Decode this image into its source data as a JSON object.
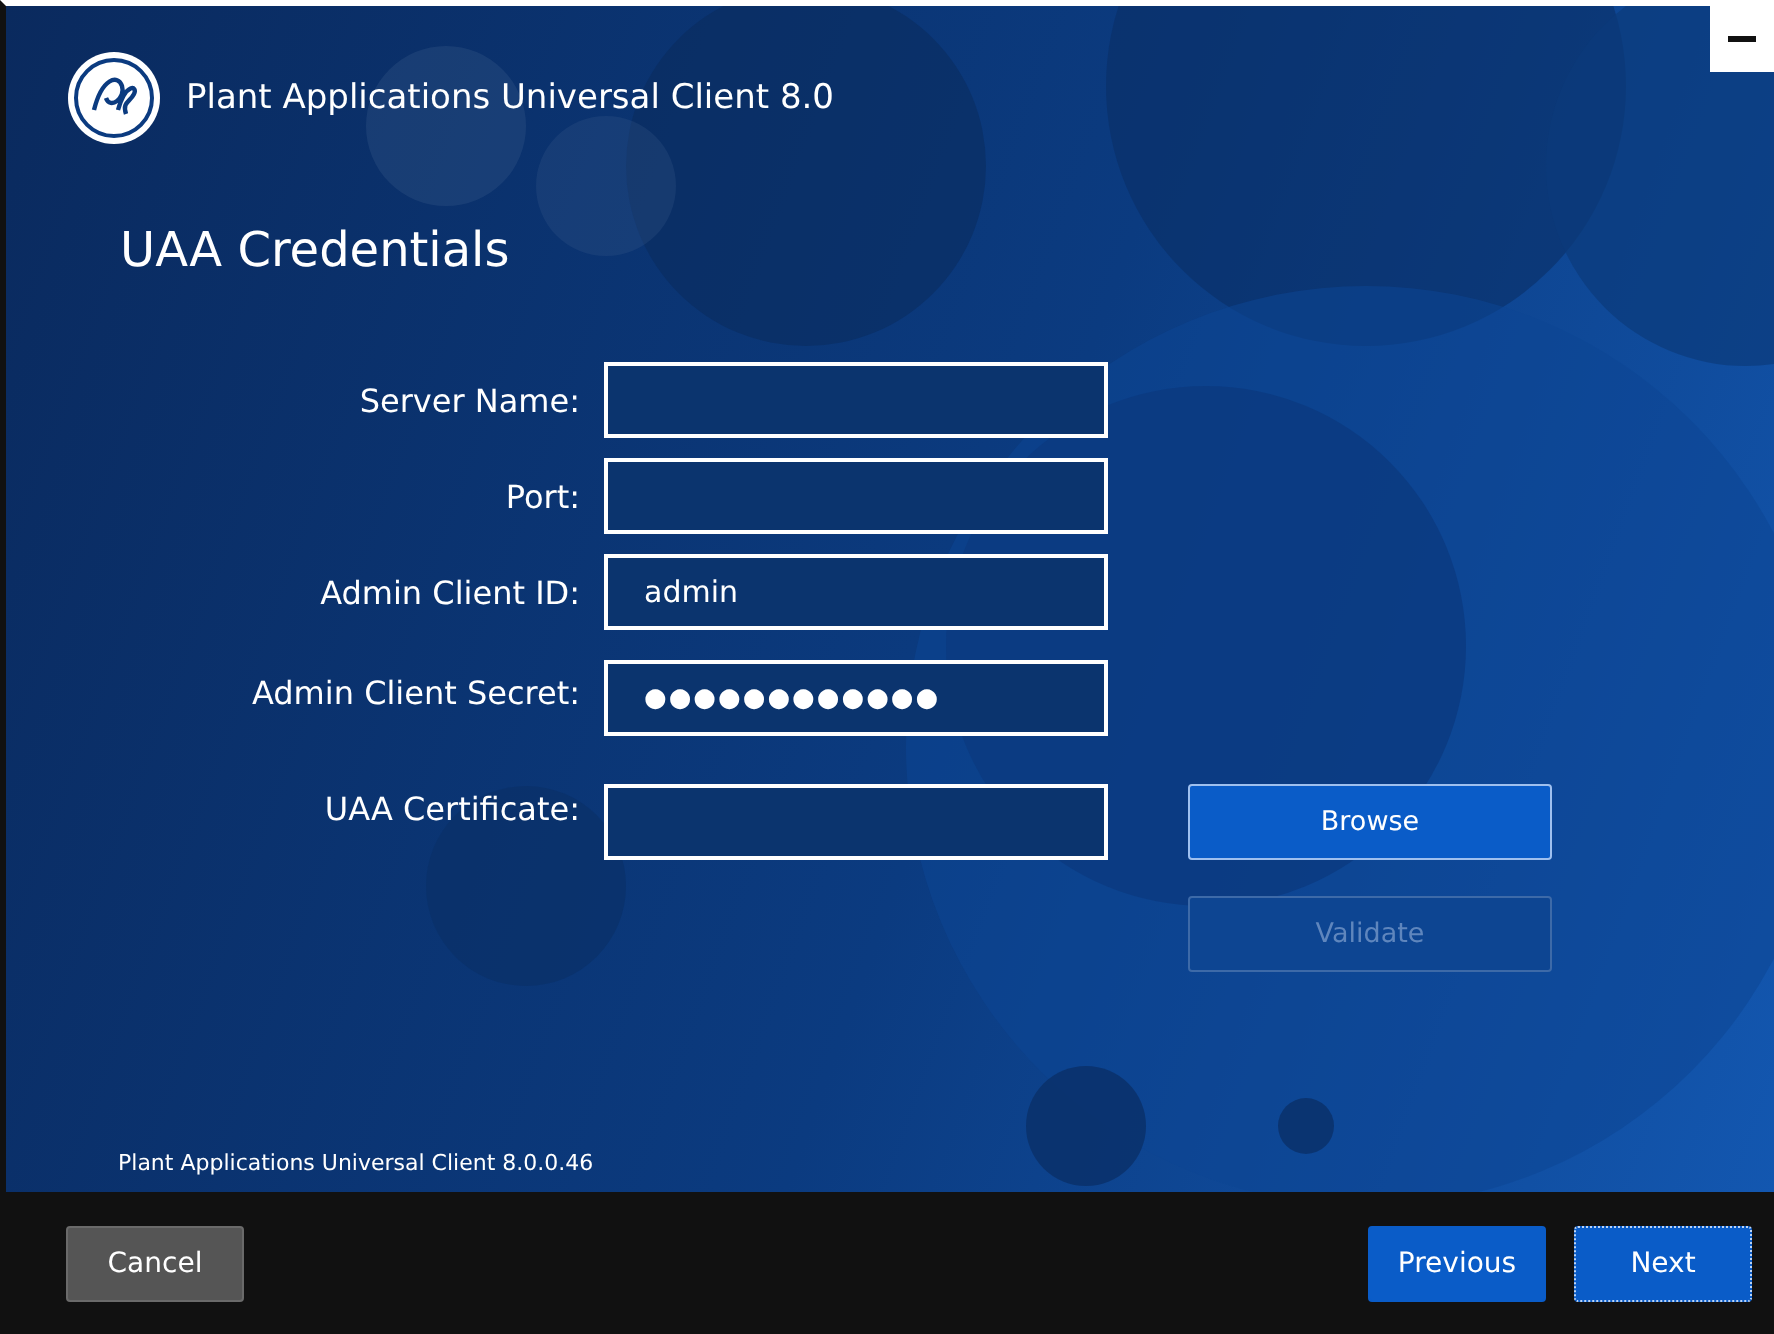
{
  "window": {
    "title": "Plant Applications Universal Client 8.0"
  },
  "page": {
    "heading": "UAA Credentials"
  },
  "fields": [
    {
      "label": "Server Name:",
      "kind": "text"
    },
    {
      "label": "Port:",
      "kind": "text"
    },
    {
      "label": "Admin Client ID:",
      "kind": "text",
      "value": "admin"
    },
    {
      "label": "Admin Client Secret:",
      "kind": "password",
      "value": "●●●●●●●●●●●●"
    },
    {
      "label": "UAA Certificate:",
      "kind": "text"
    }
  ],
  "side_buttons": [
    {
      "label": "Browse",
      "disabled": false
    },
    {
      "label": "Validate",
      "disabled": true
    }
  ],
  "version": "Plant Applications Universal Client 8.0.0.46",
  "footer_buttons": [
    {
      "label": "Cancel",
      "kind": "secondary",
      "focused": false
    },
    {
      "label": "Previous",
      "kind": "primary",
      "focused": false
    },
    {
      "label": "Next",
      "kind": "primary",
      "focused": true
    }
  ]
}
